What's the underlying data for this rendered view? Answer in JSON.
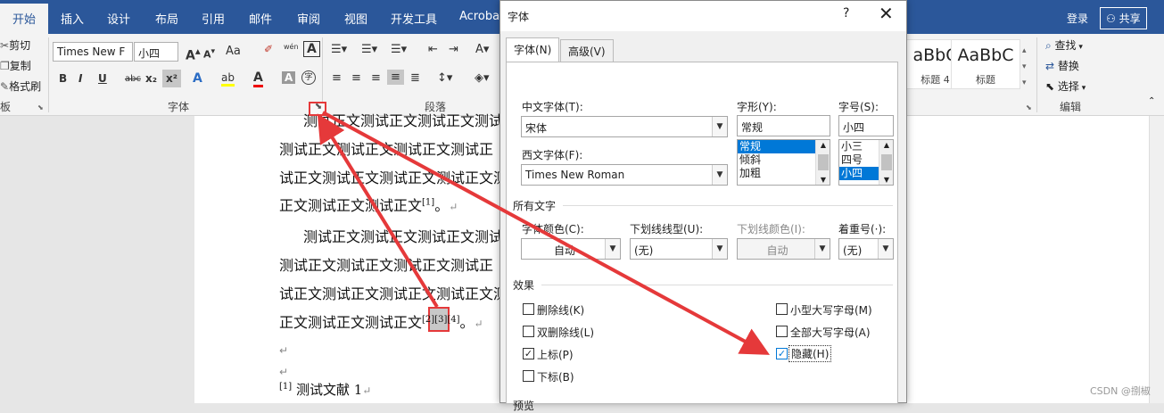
{
  "tabs": [
    "开始",
    "插入",
    "设计",
    "布局",
    "引用",
    "邮件",
    "审阅",
    "视图",
    "开发工具",
    "Acrobat"
  ],
  "account": {
    "signin": "登录",
    "share": "共享"
  },
  "clipboard": {
    "cut": "剪切",
    "copy": "复制",
    "format_painter": "格式刷",
    "group_label": "板"
  },
  "font_group": {
    "font_name": "Times New F",
    "font_size": "小四",
    "label": "字体",
    "aa": "Aa",
    "wen": "wén",
    "a_box": "A",
    "bold": "B",
    "italic": "I",
    "underline": "U",
    "strike": "abc",
    "sub": "x₂",
    "sup": "x²",
    "highlight": "ab"
  },
  "paragraph_group": {
    "label": "段落"
  },
  "styles": [
    {
      "sample": "aBbC",
      "name": "标题 4"
    },
    {
      "sample": "AaBbC",
      "name": "标题"
    }
  ],
  "editing": {
    "find": "查找",
    "replace": "替换",
    "select": "选择",
    "label": "编辑"
  },
  "document": {
    "lines": [
      "测试正文测试正文测试正文测试",
      "测试正文测试正文测试正文测试正",
      "试正文测试正文测试正文测试正文测",
      "正文测试正文测试正文",
      "测试正文测试正文测试正文测试",
      "测试正文测试正文测试正文测试正",
      "试正文测试正文测试正文测试正文测",
      "正文测试正文测试正文"
    ],
    "citation1": "[1]",
    "citation_hidden": "[2][3][4]",
    "period": "。",
    "para_mark": "↵",
    "ref_num": "[1]",
    "ref_text": "测试文献 1"
  },
  "dialog": {
    "title": "字体",
    "help": "?",
    "close": "✕",
    "tabs": [
      "字体(N)",
      "高级(V)"
    ],
    "chinese_font_label": "中文字体(T):",
    "chinese_font_value": "宋体",
    "western_font_label": "西文字体(F):",
    "western_font_value": "Times New Roman",
    "style_label": "字形(Y):",
    "style_value": "常规",
    "style_list": [
      "常规",
      "倾斜",
      "加粗"
    ],
    "size_label": "字号(S):",
    "size_value": "小四",
    "size_list": [
      "小三",
      "四号",
      "小四"
    ],
    "all_text_label": "所有文字",
    "font_color_label": "字体颜色(C):",
    "font_color_value": "自动",
    "underline_style_label": "下划线线型(U):",
    "underline_style_value": "(无)",
    "underline_color_label": "下划线颜色(I):",
    "underline_color_value": "自动",
    "emphasis_label": "着重号(·):",
    "emphasis_value": "(无)",
    "effects_label": "效果",
    "effects": [
      {
        "label": "删除线(K)",
        "checked": false
      },
      {
        "label": "双删除线(L)",
        "checked": false
      },
      {
        "label": "上标(P)",
        "checked": true
      },
      {
        "label": "下标(B)",
        "checked": false
      },
      {
        "label": "小型大写字母(M)",
        "checked": false
      },
      {
        "label": "全部大写字母(A)",
        "checked": false
      },
      {
        "label": "隐藏(H)",
        "checked": true
      }
    ],
    "preview_label": "预览"
  },
  "watermark": "CSDN @捌椒",
  "colors": {
    "ribbon": "#2b579a",
    "arrow": "#e5393a",
    "selection": "#0078d7"
  }
}
